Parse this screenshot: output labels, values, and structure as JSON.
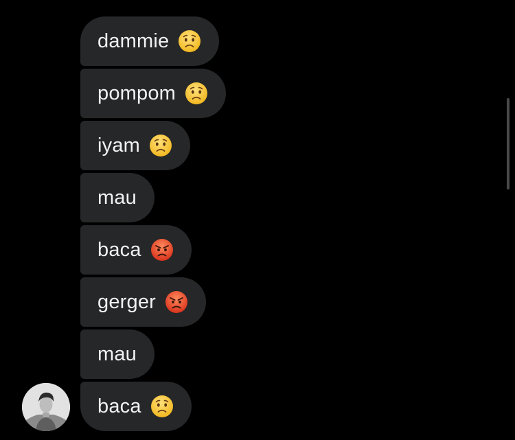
{
  "messages": [
    {
      "text": "dammie",
      "emoji": "worried-face-icon"
    },
    {
      "text": "pompom",
      "emoji": "worried-face-icon"
    },
    {
      "text": "iyam",
      "emoji": "worried-face-icon"
    },
    {
      "text": "mau",
      "emoji": ""
    },
    {
      "text": "baca",
      "emoji": "angry-face-icon"
    },
    {
      "text": "gerger",
      "emoji": "angry-face-icon"
    },
    {
      "text": "mau",
      "emoji": ""
    },
    {
      "text": "baca",
      "emoji": "worried-face-icon"
    }
  ],
  "colors": {
    "background": "#000000",
    "bubble": "#262729",
    "text": "#f2f2f2",
    "worried_face": "#f7c531",
    "angry_face": "#e8452a"
  },
  "icons": {
    "sender_avatar": "sender-avatar-photo"
  }
}
